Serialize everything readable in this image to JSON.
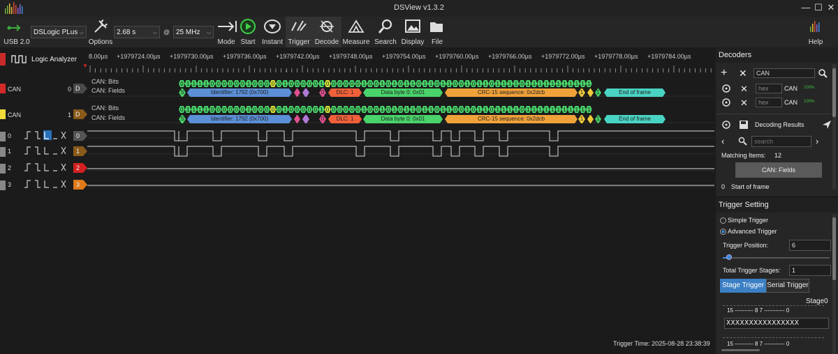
{
  "window": {
    "title": "DSView v1.3.2",
    "min": "—",
    "max": "☐",
    "close": "✕"
  },
  "toolbar": {
    "device": "USB 2.0",
    "device_name": "DSLogic PLus",
    "options": "Options",
    "sample_time": "2.68 s",
    "at": "@",
    "sample_rate": "25 MHz",
    "mode": "Mode",
    "start": "Start",
    "instant": "Instant",
    "trigger": "Trigger",
    "decode": "Decode",
    "measure": "Measure",
    "search": "Search",
    "display": "Display",
    "file": "File",
    "help": "Help"
  },
  "ruler": {
    "first": "8.00µs",
    "ticks": [
      "+1979724.00µs",
      "+1979730.00µs",
      "+1979736.00µs",
      "+1979742.00µs",
      "+1979748.00µs",
      "+1979754.00µs",
      "+1979760.00µs",
      "+1979766.00µs",
      "+1979772.00µs",
      "+1979778.00µs",
      "+1979784.00µs"
    ]
  },
  "channels": {
    "la_label": "Logic Analyzer",
    "can0": {
      "name": "CAN",
      "index": "0",
      "tag": "D",
      "color": "#e33b3b"
    },
    "can1": {
      "name": "CAN",
      "index": "1",
      "tag": "D",
      "color": "#f5e13b"
    },
    "bits_label": "CAN: Bits",
    "fields_label": "CAN: Fields",
    "digital": [
      {
        "num": "0",
        "tag": "0",
        "color": "#555555"
      },
      {
        "num": "1",
        "tag": "1",
        "color": "#8a5a1a"
      },
      {
        "num": "2",
        "tag": "2",
        "color": "#d42020"
      },
      {
        "num": "3",
        "tag": "3",
        "color": "#e07a1a"
      }
    ]
  },
  "decode": {
    "bits": "01111000000100000100000100000010010101101101100101101111011111111111",
    "fields": {
      "s": "S",
      "identifier": "Identifier: 1792 (0x700)",
      "zero": "0",
      "dlc": "DLC: 1",
      "data": "Data byte 0: 0x01",
      "crc": "CRC-15 sequence: 0x2dcb",
      "one_a": "1",
      "one_b": "1",
      "eof": "End of frame"
    }
  },
  "decoders": {
    "header": "Decoders",
    "protocol": "CAN",
    "rows": [
      {
        "format": "hex",
        "name": "CAN",
        "pct": "100%"
      },
      {
        "format": "hex",
        "name": "CAN",
        "pct": "100%"
      }
    ],
    "results_label": "Decoding Results",
    "search_placeholder": "search",
    "matching": "Matching Items:",
    "matching_count": "12",
    "selected": "CAN: Fields",
    "first_row_idx": "0",
    "first_row_text": "Start of frame"
  },
  "trigger": {
    "header": "Trigger Setting",
    "simple": "Simple Trigger",
    "advanced": "Advanced Trigger",
    "position_label": "Trigger Position:",
    "position": "6",
    "position_fraction": 0.06,
    "stages_label": "Total Trigger Stages:",
    "stages": "1",
    "stage_tab": "Stage Trigger",
    "serial_tab": "Serial Trigger",
    "stage0": "Stage0",
    "bits_header": "15 ---------- 8 7 ----------- 0",
    "pattern": "XXXXXXXXXXXXXXXX",
    "bits_header2": "15 ---------- 8 7 ----------- 0"
  },
  "status": {
    "trigger_time": "Trigger Time: 2025-08-28 23:38:39"
  }
}
